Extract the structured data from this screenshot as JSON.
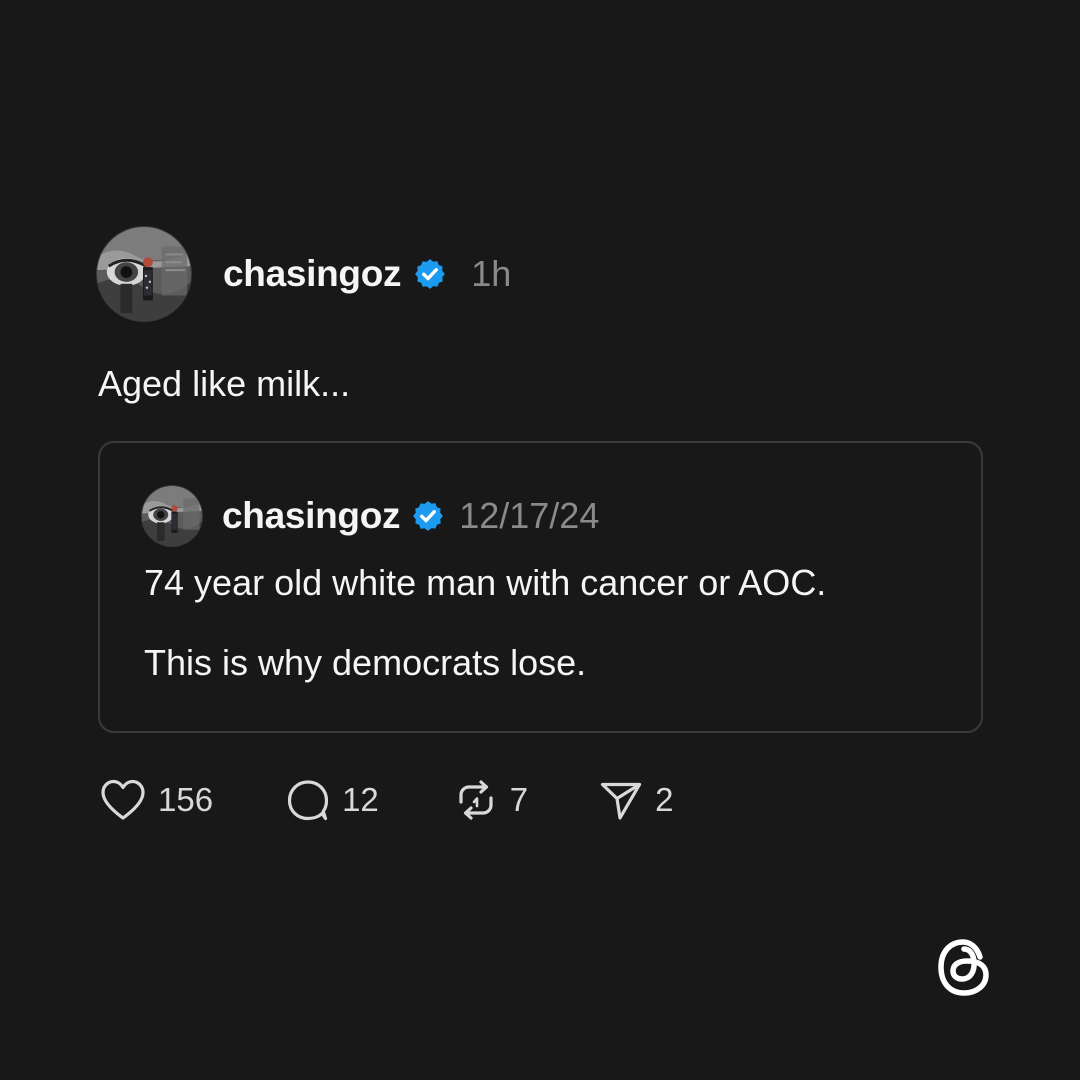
{
  "post": {
    "username": "chasingoz",
    "time": "1h",
    "text": "Aged like milk..."
  },
  "quote": {
    "username": "chasingoz",
    "date": "12/17/24",
    "lines": [
      "74 year old white man with cancer or AOC.",
      "This is why democrats lose."
    ]
  },
  "actions": {
    "likes": "156",
    "replies": "12",
    "reposts": "7",
    "shares": "2"
  },
  "icons": {
    "verified": "verified-badge-icon",
    "like": "heart-icon",
    "reply": "speech-bubble-icon",
    "repost": "repost-arrows-icon",
    "share": "paper-plane-icon",
    "brand": "threads-logo-icon"
  },
  "colors": {
    "background": "#181818",
    "text": "#f3f5f7",
    "muted": "#8a8a8a",
    "verified": "#1d9bf0",
    "border": "#3a3a3a"
  }
}
